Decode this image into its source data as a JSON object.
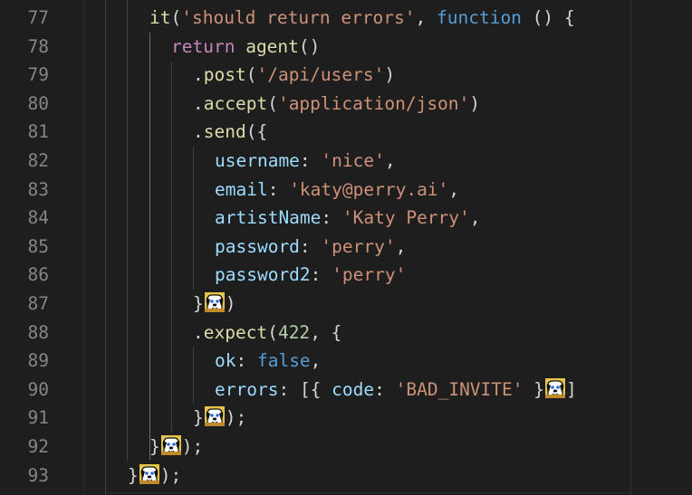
{
  "line_numbers": [
    "77",
    "78",
    "79",
    "80",
    "81",
    "82",
    "83",
    "84",
    "85",
    "86",
    "87",
    "88",
    "89",
    "90",
    "91",
    "92",
    "93"
  ],
  "code": {
    "l77": {
      "fn": "it",
      "open": "(",
      "str": "'should return errors'",
      "comma": ", ",
      "kw": "function",
      "rest": " () {"
    },
    "l78": {
      "kw": "return",
      "sp": " ",
      "fn": "agent",
      "rest": "()"
    },
    "l79": {
      "dot": ".",
      "fn": "post",
      "open": "(",
      "str": "'/api/users'",
      "close": ")"
    },
    "l80": {
      "dot": ".",
      "fn": "accept",
      "open": "(",
      "str": "'application/json'",
      "close": ")"
    },
    "l81": {
      "dot": ".",
      "fn": "send",
      "rest": "({"
    },
    "l82": {
      "prop": "username",
      "colon": ": ",
      "str": "'nice'",
      "comma": ","
    },
    "l83": {
      "prop": "email",
      "colon": ": ",
      "str": "'katy@perry.ai'",
      "comma": ","
    },
    "l84": {
      "prop": "artistName",
      "colon": ": ",
      "str": "'Katy Perry'",
      "comma": ","
    },
    "l85": {
      "prop": "password",
      "colon": ": ",
      "str": "'perry'",
      "comma": ","
    },
    "l86": {
      "prop": "password2",
      "colon": ": ",
      "str": "'perry'"
    },
    "l87": {
      "open": "}",
      "close": ")"
    },
    "l88": {
      "dot": ".",
      "fn": "expect",
      "open": "(",
      "num": "422",
      "rest": ", {"
    },
    "l89": {
      "prop": "ok",
      "colon": ": ",
      "kw": "false",
      "comma": ","
    },
    "l90": {
      "prop": "errors",
      "colon": ": ",
      "mid": "[{ ",
      "prop2": "code",
      "colon2": ": ",
      "str": "'BAD_INVITE'",
      "mid2": " }",
      "close": "]"
    },
    "l91": {
      "open": "}",
      "close": ");"
    },
    "l92": {
      "open": "}",
      "close": ");"
    },
    "l93": {
      "open": "}",
      "close": ");"
    }
  },
  "icons": {
    "emoji": "cartoon-dog-face-icon"
  },
  "colors": {
    "background": "#1e1e1e",
    "line_number": "#858585",
    "function": "#dcdcaa",
    "string": "#ce9178",
    "keyword": "#569cd6",
    "control": "#c586c0",
    "property": "#9cdcfe",
    "number": "#b5cea8",
    "punctuation": "#d4d4d4"
  }
}
